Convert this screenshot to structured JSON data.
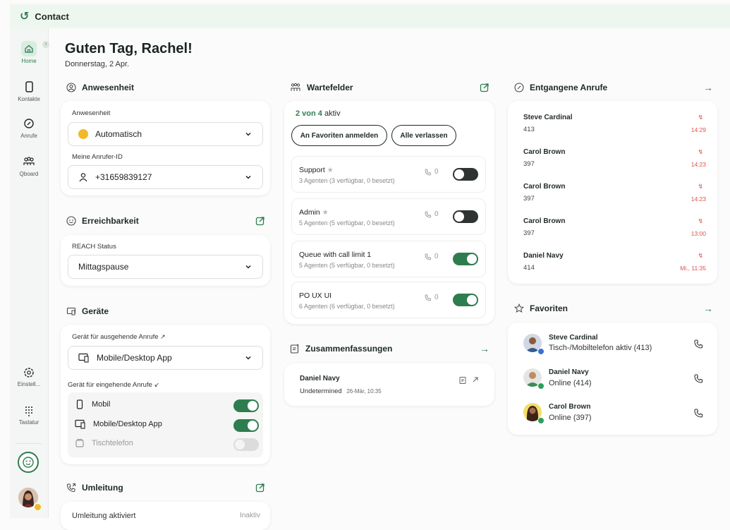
{
  "app": {
    "title": "Contact"
  },
  "sidebar": {
    "items": [
      {
        "label": "Home"
      },
      {
        "label": "Kontakte"
      },
      {
        "label": "Anrufe"
      },
      {
        "label": "Qboard"
      },
      {
        "label": "Einstell..."
      },
      {
        "label": "Tastatur"
      }
    ]
  },
  "header": {
    "greeting": "Guten Tag, Rachel!",
    "date": "Donnerstag, 2 Apr."
  },
  "presence": {
    "title": "Anwesenheit",
    "label": "Anwesenheit",
    "value": "Automatisch",
    "caller_id_label": "Meine Anrufer-ID",
    "caller_id": "+31659839127"
  },
  "reachability": {
    "title": "Erreichbarkeit",
    "label": "REACH Status",
    "value": "Mittagspause"
  },
  "devices": {
    "title": "Geräte",
    "outgoing_label": "Gerät für ausgehende Anrufe",
    "outgoing_value": "Mobile/Desktop App",
    "incoming_label": "Gerät für eingehende Anrufe",
    "incoming": [
      {
        "label": "Mobil",
        "state": "on"
      },
      {
        "label": "Mobile/Desktop App",
        "state": "on"
      },
      {
        "label": "Tischtelefon",
        "state": "disabled"
      }
    ]
  },
  "forwarding": {
    "title": "Umleitung",
    "label": "Umleitung aktiviert",
    "value": "Inaktiv"
  },
  "queues": {
    "title": "Wartefelder",
    "active_count": "2 von 4",
    "active_suffix": "aktiv",
    "login_favorites": "An Favoriten anmelden",
    "leave_all": "Alle verlassen",
    "items": [
      {
        "name": "Support",
        "agents": "3 Agenten (3 verfügbar, 0 besetzt)",
        "calls": "0",
        "active": false,
        "favorite": true
      },
      {
        "name": "Admin",
        "agents": "5 Agenten (5 verfügbar, 0 besetzt)",
        "calls": "0",
        "active": false,
        "favorite": true
      },
      {
        "name": "Queue with call limit 1",
        "agents": "5 Agenten (5 verfügbar, 0 besetzt)",
        "calls": "0",
        "active": true,
        "favorite": false
      },
      {
        "name": "PO UX UI",
        "agents": "6 Agenten (6 verfügbar, 0 besetzt)",
        "calls": "0",
        "active": true,
        "favorite": false
      }
    ]
  },
  "summaries": {
    "title": "Zusammenfassungen",
    "items": [
      {
        "name": "Daniel Navy",
        "status": "Undetermined",
        "time": "26-Mär, 10:35"
      }
    ]
  },
  "missed_calls": {
    "title": "Entgangene Anrufe",
    "items": [
      {
        "name": "Steve Cardinal",
        "number": "413",
        "time": "14:29"
      },
      {
        "name": "Carol Brown",
        "number": "397",
        "time": "14:23"
      },
      {
        "name": "Carol Brown",
        "number": "397",
        "time": "14:23"
      },
      {
        "name": "Carol Brown",
        "number": "397",
        "time": "13:00"
      },
      {
        "name": "Daniel Navy",
        "number": "414",
        "time": "Mi., 11:35"
      }
    ]
  },
  "favorites": {
    "title": "Favoriten",
    "items": [
      {
        "name": "Steve Cardinal",
        "status": "Tisch-/Mobiltelefon aktiv (413)",
        "dot_color": "#3b6fd8"
      },
      {
        "name": "Daniel Navy",
        "status": "Online (414)",
        "dot_color": "#2e9e5a"
      },
      {
        "name": "Carol Brown",
        "status": "Online (397)",
        "dot_color": "#2e9e5a"
      }
    ]
  },
  "colors": {
    "accent": "#2e7d4f",
    "missed": "#d9534f",
    "away": "#f2b827"
  }
}
